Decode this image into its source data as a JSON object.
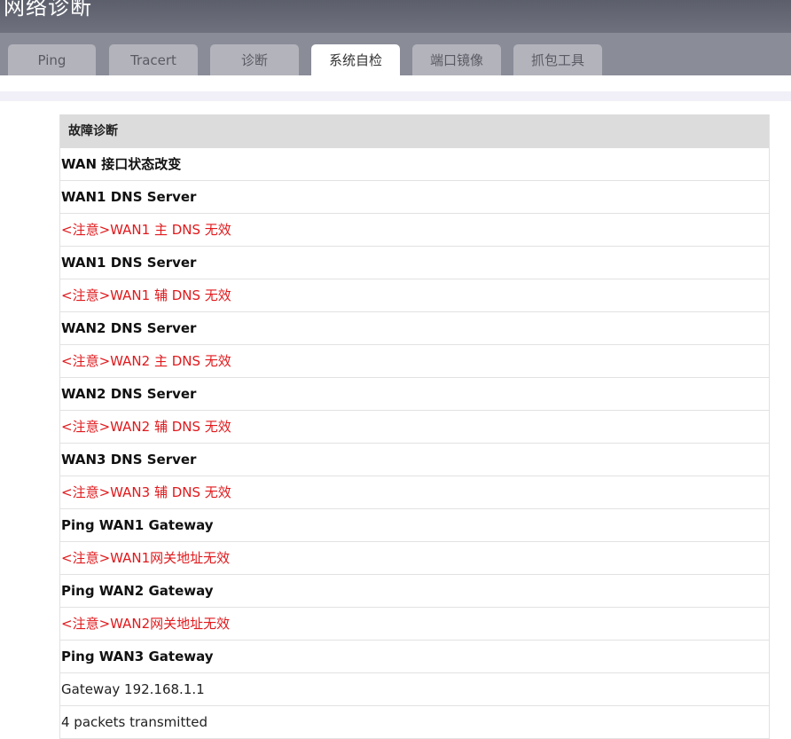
{
  "header": {
    "title": "网络诊断"
  },
  "tabs": [
    {
      "label": "Ping",
      "active": false
    },
    {
      "label": "Tracert",
      "active": false
    },
    {
      "label": "诊断",
      "active": false
    },
    {
      "label": "系统自检",
      "active": true
    },
    {
      "label": "端口镜像",
      "active": false
    },
    {
      "label": "抓包工具",
      "active": false
    }
  ],
  "panel": {
    "title": "故障诊断",
    "rows": [
      {
        "text": "WAN 接口状态改变",
        "kind": "heading"
      },
      {
        "text": "WAN1 DNS Server",
        "kind": "heading"
      },
      {
        "text": "<注意>WAN1 主 DNS 无效",
        "kind": "warning"
      },
      {
        "text": "WAN1 DNS Server",
        "kind": "heading"
      },
      {
        "text": "<注意>WAN1 辅 DNS 无效",
        "kind": "warning"
      },
      {
        "text": "WAN2 DNS Server",
        "kind": "heading"
      },
      {
        "text": "<注意>WAN2 主 DNS 无效",
        "kind": "warning"
      },
      {
        "text": "WAN2 DNS Server",
        "kind": "heading"
      },
      {
        "text": "<注意>WAN2 辅 DNS 无效",
        "kind": "warning"
      },
      {
        "text": "WAN3 DNS Server",
        "kind": "heading"
      },
      {
        "text": "<注意>WAN3 辅 DNS 无效",
        "kind": "warning"
      },
      {
        "text": "Ping WAN1 Gateway",
        "kind": "heading"
      },
      {
        "text": "<注意>WAN1网关地址无效",
        "kind": "warning"
      },
      {
        "text": "Ping WAN2 Gateway",
        "kind": "heading"
      },
      {
        "text": "<注意>WAN2网关地址无效",
        "kind": "warning"
      },
      {
        "text": "Ping WAN3 Gateway",
        "kind": "heading"
      },
      {
        "text": "Gateway 192.168.1.1",
        "kind": "info"
      },
      {
        "text": "4 packets transmitted",
        "kind": "info"
      }
    ]
  },
  "colors": {
    "warning": "#e0191c",
    "tab_strip": "#8a8c98",
    "title_bar": "#5c5f6b"
  }
}
